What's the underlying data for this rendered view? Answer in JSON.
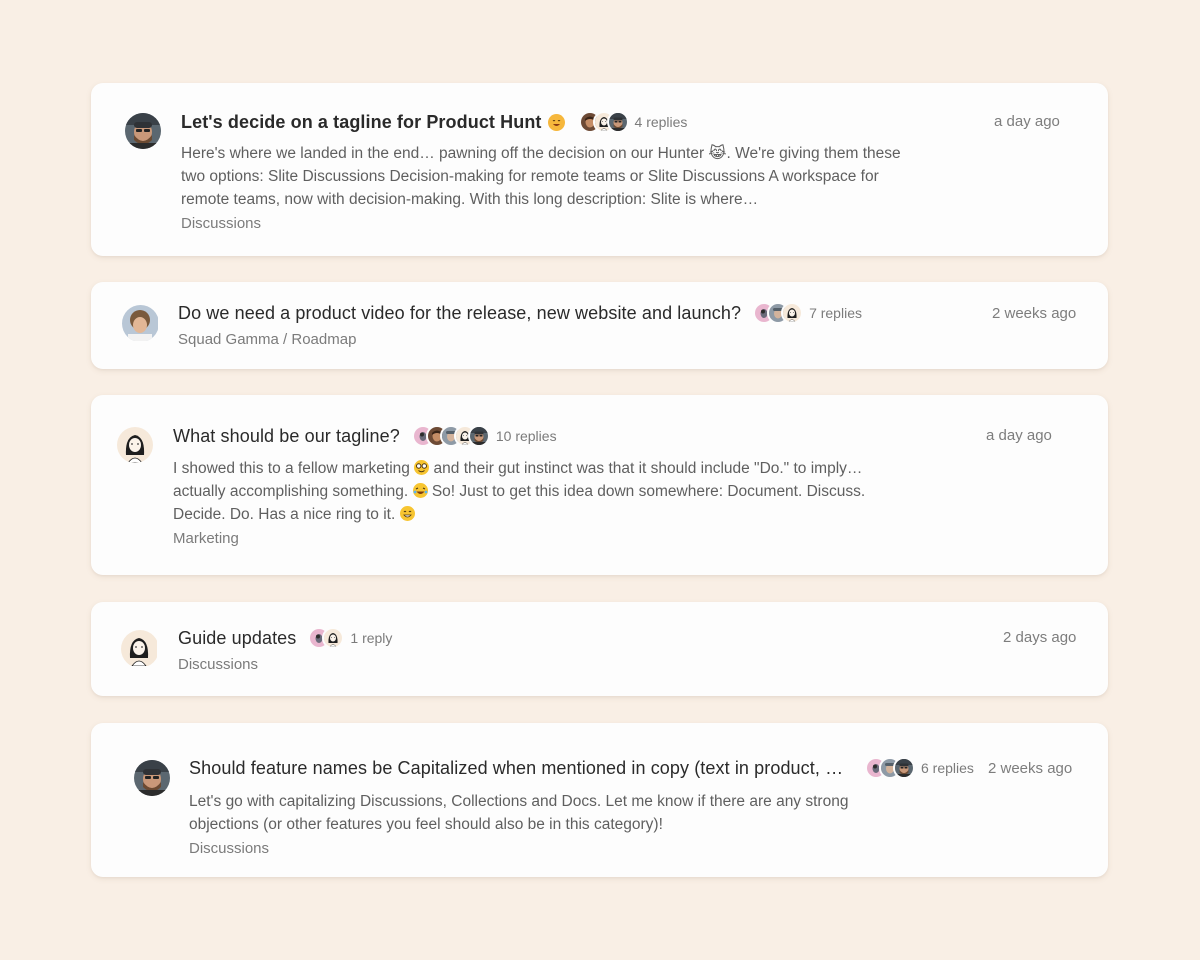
{
  "threads": [
    {
      "title": "Let's decide on a tagline for Product Hunt",
      "title_emoji": "cat-smile-emoji",
      "replies": "4 replies",
      "time": "a day ago",
      "excerpt": "Here's where we landed in the end… pawning off the decision on our Hunter 😹. We're giving them these two options: Slite Discussions Decision-making for remote teams or Slite Discussions A workspace for remote teams, now with decision-making. With this long description: Slite is where…",
      "channel": "Discussions"
    },
    {
      "title": "Do we need a product video for the release, new website and launch?",
      "replies": "7 replies",
      "time": "2 weeks ago",
      "channel": "Squad Gamma / Roadmap"
    },
    {
      "title": "What should be our tagline?",
      "replies": "10 replies",
      "time": "a day ago",
      "excerpt_parts": [
        "I showed this to a fellow marketing ",
        " and their gut instinct was that it should include \"Do.\" to imply… actually accomplishing something. ",
        " So! Just to get this idea down somewhere: Document. Discuss. Decide. Do. Has a nice ring to it. "
      ],
      "channel": "Marketing"
    },
    {
      "title": "Guide updates",
      "replies": "1 reply",
      "time": "2 days ago",
      "channel": "Discussions"
    },
    {
      "title": "Should feature names be Capitalized when mentioned in copy (text in product, website, etc)?",
      "replies": "6 replies",
      "time": "2 weeks ago",
      "excerpt": "Let's go with capitalizing Discussions, Collections and Docs. Let me know if there are any strong objections (or other features you feel should also be in this category)!",
      "channel": "Discussions"
    }
  ],
  "colors": {
    "background": "#f9efe5",
    "card": "#fdfdfd",
    "muted_text": "#7b7b7b"
  }
}
